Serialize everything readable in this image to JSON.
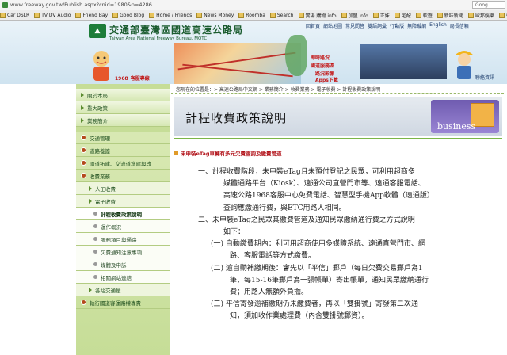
{
  "browser": {
    "url": "www.freeway.gov.tw/Publish.aspx?cnid=1980&p=4286",
    "search_placeholder": "Goog"
  },
  "bookmarks": [
    "Car DSLR",
    "TV DV Audio",
    "Friend Bay",
    "Good Blog",
    "Home / Friends",
    "News Money",
    "Roomba",
    "Search",
    "實場 購物 info",
    "加盟 info",
    "正妹",
    "宅配",
    "軟遊",
    "新味新聞",
    "歐邦娛樂",
    "餐"
  ],
  "header": {
    "org_cn": "交通部臺灣區國道高速公路局",
    "org_en": "Taiwan Area National Freeway Bureau, MOTC",
    "badge_year": "1968",
    "badge_text": "客服專線",
    "top_nav": [
      "回首頁",
      "網站地圖",
      "常見問答",
      "雙語詞彙",
      "行動版",
      "無障礙網",
      "English",
      "局長信箱"
    ],
    "quick_links": [
      "即時路況",
      "國道服務區",
      "路況影像",
      "Apps下載"
    ],
    "contact_label": "聯絡資訊"
  },
  "sidebar": {
    "items": [
      {
        "label": "關於本局",
        "type": "main"
      },
      {
        "label": "重大政策",
        "type": "main"
      },
      {
        "label": "業務簡介",
        "type": "main"
      },
      {
        "label": "交通管理",
        "type": "cat"
      },
      {
        "label": "道路養護",
        "type": "cat"
      },
      {
        "label": "國道拓建、交流道增建與改",
        "type": "cat"
      },
      {
        "label": "收費業務",
        "type": "cat"
      },
      {
        "label": "人工收費",
        "type": "sub"
      },
      {
        "label": "電子收費",
        "type": "sub"
      },
      {
        "label": "計程收費政策說明",
        "type": "sub2",
        "active": true
      },
      {
        "label": "運作概況",
        "type": "sub2"
      },
      {
        "label": "服務項目與通路",
        "type": "sub2"
      },
      {
        "label": "欠費通知注意事項",
        "type": "sub2"
      },
      {
        "label": "媒體及申訴",
        "type": "sub2"
      },
      {
        "label": "相關網站連結",
        "type": "sub2"
      },
      {
        "label": "各站交通量",
        "type": "sub"
      },
      {
        "label": "執行國道客運路權專責",
        "type": "cat"
      }
    ]
  },
  "content": {
    "breadcrumb": "您現在的位置是：> 高速公路局中文網 > 業務簡介 > 收費業務 > 電子收費 > 計程收費政策說明",
    "title": "計程收費政策說明",
    "title_deco_word": "business",
    "section_head": "未申裝eTag車輛有多元欠費查詢及繳費管道",
    "paragraphs": [
      {
        "text": "一、計程收費階段，未申裝eTag且未預付登記之民眾，可利用超商多",
        "indent": 36
      },
      {
        "text": "媒體通路平台（Kiosk）、遠通公司直營門市等、遠通客服電話、",
        "indent": 68
      },
      {
        "text": "高速公路1968客服中心免費電話、智慧型手機App軟體（遠通版）",
        "indent": 68
      },
      {
        "text": "查詢應繳通行費，與ETC用路人相同。",
        "indent": 68
      },
      {
        "text": "二、未申裝eTag之民眾其繳費管道及通知民眾繳納通行費之方式說明",
        "indent": 36
      },
      {
        "text": "如下：",
        "indent": 68
      },
      {
        "text": "(一) 自動繳費期內：利可用超商使用多媒體系統、遠通直營門市、網",
        "indent": 52
      },
      {
        "text": "路、客服電話等方式繳費。",
        "indent": 76
      },
      {
        "text": "(二) 逾自動補繳期後：會先以「平信」郵戶（每日欠費交易郵戶為1",
        "indent": 52
      },
      {
        "text": "筆，每15-16筆郵戶為一張帳單）寄出帳單，通知民眾繳納通行",
        "indent": 76
      },
      {
        "text": "費；用路人無額外負擔。",
        "indent": 76
      },
      {
        "text": "(三) 平信寄發逾補繳期仍未繳費者，再以「雙掛號」寄發第二次通",
        "indent": 52
      },
      {
        "text": "知，須加收作業處理費（內含雙掛號郵資）。",
        "indent": 76
      }
    ]
  },
  "colors": {
    "sidebar_green": "#c6dd97",
    "accent_red": "#b2131a",
    "title_band": "#cfd7e2",
    "deco_purple": "#6f5bb0"
  }
}
